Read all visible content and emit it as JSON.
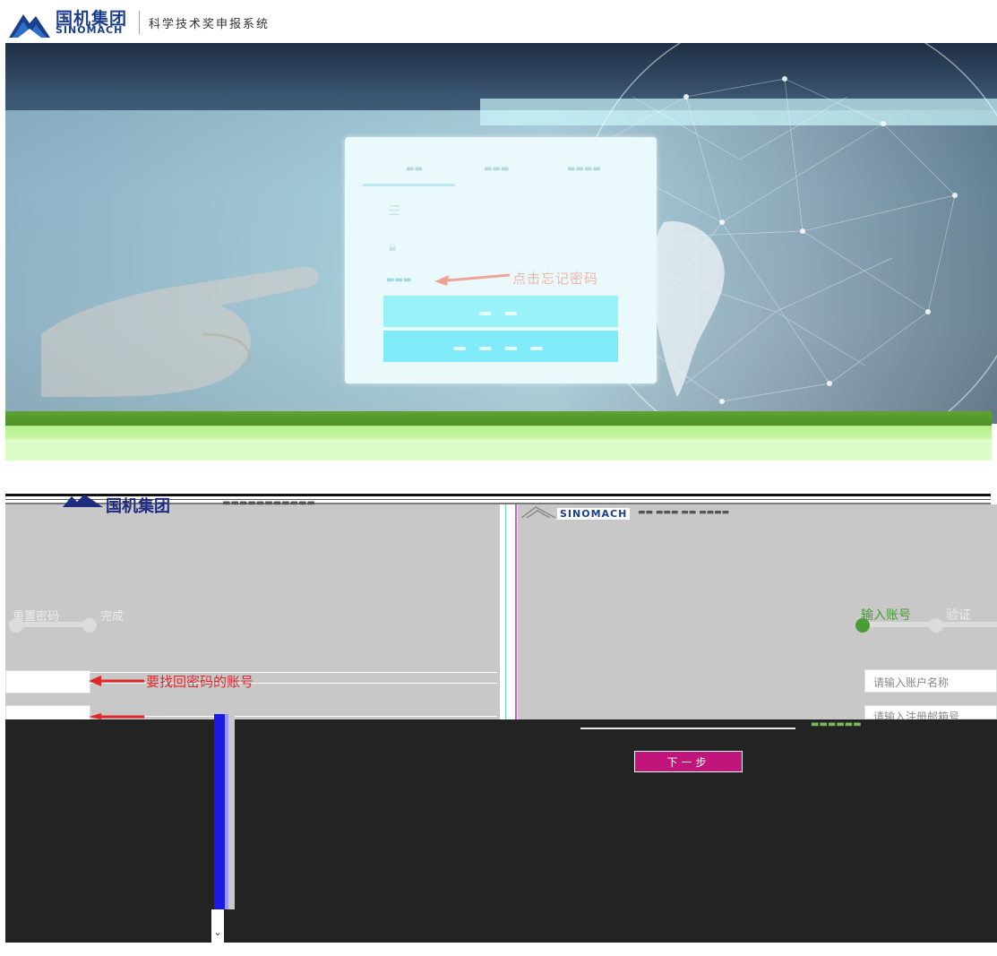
{
  "header": {
    "brand_cn": "国机集团",
    "brand_en": "SINOMACH",
    "system_title": "科学技术奖申报系统"
  },
  "login_screen": {
    "annotation_forgot": "点击忘记密码"
  },
  "reset_screen": {
    "brand_cn": "国机集团",
    "brand_en": "SINOMACH",
    "steps_left": [
      "重置密码",
      "完成"
    ],
    "steps_right": [
      "输入账号",
      "验证"
    ],
    "annotation_account": "要找回密码的账号",
    "account_placeholder": "请输入账户名称",
    "email_placeholder": "请输入注册邮箱号",
    "next_button": "下一步"
  },
  "colors": {
    "brand_blue": "#1b3f8c",
    "step_active_green": "#4a9c37",
    "annotation_red": "#e2272b",
    "next_button_bg": "#c2157b"
  }
}
